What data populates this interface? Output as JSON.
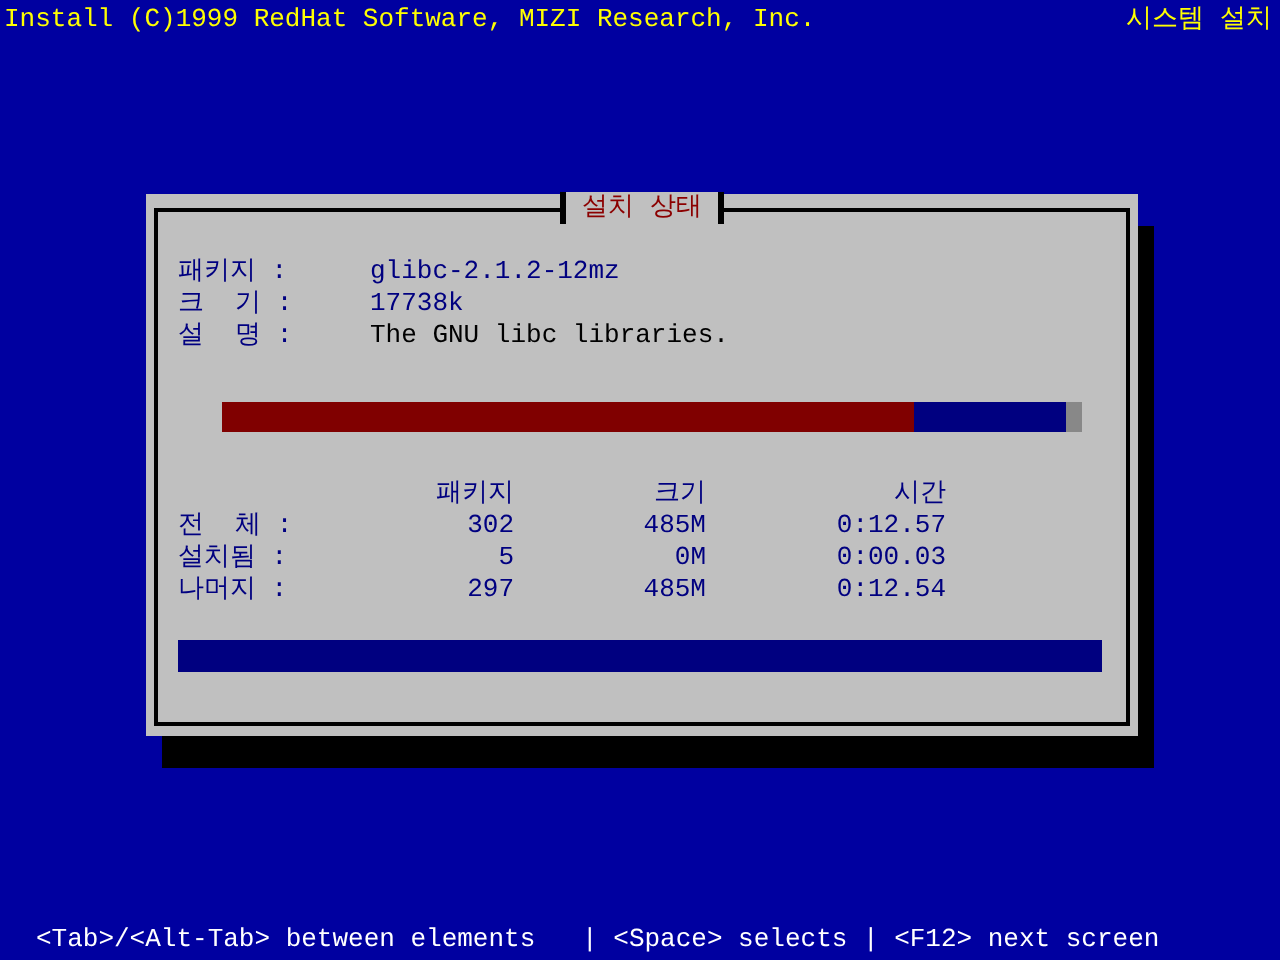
{
  "header": {
    "title": "Install (C)1999 RedHat Software, MIZI Research, Inc.",
    "section": "시스템 설치"
  },
  "dialog": {
    "title": "설치 상태",
    "fields": [
      {
        "label": "패키지 :",
        "value": "glibc-2.1.2-12mz",
        "kind": "info"
      },
      {
        "label": "크  기 :",
        "value": "17738k",
        "kind": "info"
      },
      {
        "label": "설  명 :",
        "value": "The GNU libc libraries.",
        "kind": "text"
      }
    ],
    "package_progress": {
      "level": 0.82
    },
    "columns": [
      "패키지",
      "크기",
      "시간"
    ],
    "rows": [
      {
        "label": "전  체 :",
        "cells": [
          "302",
          "485M",
          "0:12.57"
        ]
      },
      {
        "label": "설치됨 :",
        "cells": [
          "5",
          "0M",
          "0:00.03"
        ]
      },
      {
        "label": "나머지 :",
        "cells": [
          "297",
          "485M",
          "0:12.54"
        ]
      }
    ],
    "total_progress": {
      "level": 0
    }
  },
  "status_bar": "<Tab>/<Alt-Tab> between elements   | <Space> selects | <F12> next screen"
}
